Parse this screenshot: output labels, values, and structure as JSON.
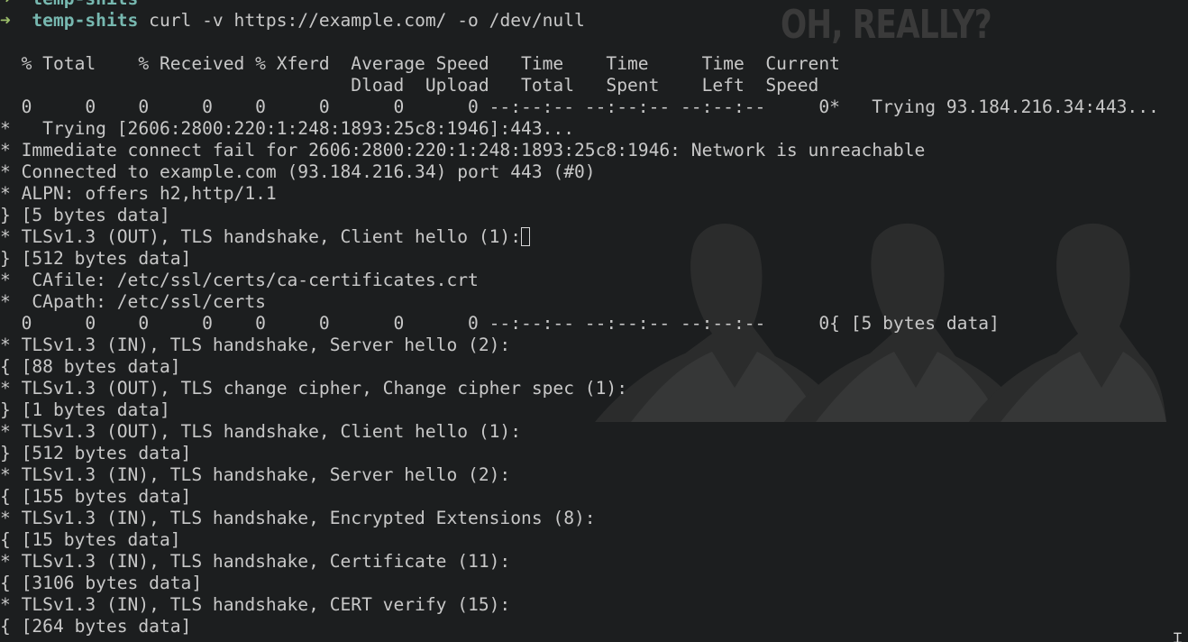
{
  "prompt": {
    "arrow": "➜",
    "directory": "temp-shits",
    "command": "curl -v https://example.com/ -o /dev/null"
  },
  "wallpaper": {
    "caption": "OH, REALLY?",
    "colors": {
      "silhouette": "#2a2b2c",
      "shirt": "#3a3b3c",
      "skin": "#343434"
    }
  },
  "output_lines": [
    "  % Total    % Received % Xferd  Average Speed   Time    Time     Time  Current",
    "                                 Dload  Upload   Total   Spent    Left  Speed",
    "  0     0    0     0    0     0      0      0 --:--:-- --:--:-- --:--:--     0*   Trying 93.184.216.34:443...",
    "*   Trying [2606:2800:220:1:248:1893:25c8:1946]:443...",
    "* Immediate connect fail for 2606:2800:220:1:248:1893:25c8:1946: Network is unreachable",
    "* Connected to example.com (93.184.216.34) port 443 (#0)",
    "* ALPN: offers h2,http/1.1",
    "} [5 bytes data]",
    "* TLSv1.3 (OUT), TLS handshake, Client hello (1):",
    "} [512 bytes data]",
    "*  CAfile: /etc/ssl/certs/ca-certificates.crt",
    "*  CApath: /etc/ssl/certs",
    "  0     0    0     0    0     0      0      0 --:--:-- --:--:-- --:--:--     0{ [5 bytes data]",
    "* TLSv1.3 (IN), TLS handshake, Server hello (2):",
    "{ [88 bytes data]",
    "* TLSv1.3 (OUT), TLS change cipher, Change cipher spec (1):",
    "} [1 bytes data]",
    "* TLSv1.3 (OUT), TLS handshake, Client hello (1):",
    "} [512 bytes data]",
    "* TLSv1.3 (IN), TLS handshake, Server hello (2):",
    "{ [155 bytes data]",
    "* TLSv1.3 (IN), TLS handshake, Encrypted Extensions (8):",
    "{ [15 bytes data]",
    "* TLSv1.3 (IN), TLS handshake, Certificate (11):",
    "{ [3106 bytes data]",
    "* TLSv1.3 (IN), TLS handshake, CERT verify (15):",
    "{ [264 bytes data]"
  ],
  "text_cursor_after_line": 8,
  "mouse_cursor": "I-beam"
}
